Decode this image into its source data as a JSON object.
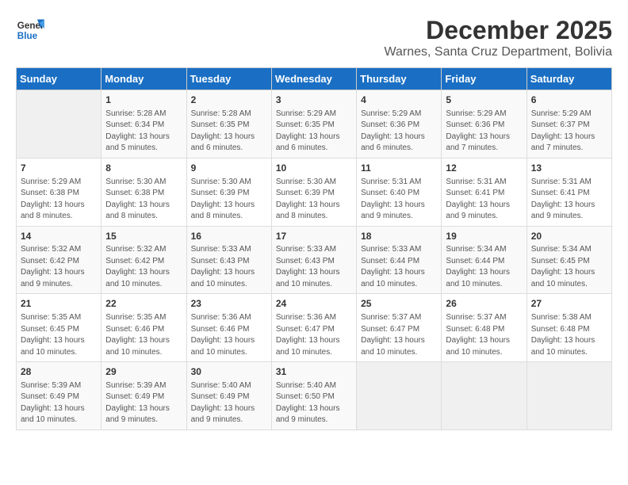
{
  "logo": {
    "line1": "General",
    "line2": "Blue"
  },
  "title": "December 2025",
  "location": "Warnes, Santa Cruz Department, Bolivia",
  "days_of_week": [
    "Sunday",
    "Monday",
    "Tuesday",
    "Wednesday",
    "Thursday",
    "Friday",
    "Saturday"
  ],
  "weeks": [
    [
      {
        "day": "",
        "info": ""
      },
      {
        "day": "1",
        "info": "Sunrise: 5:28 AM\nSunset: 6:34 PM\nDaylight: 13 hours\nand 5 minutes."
      },
      {
        "day": "2",
        "info": "Sunrise: 5:28 AM\nSunset: 6:35 PM\nDaylight: 13 hours\nand 6 minutes."
      },
      {
        "day": "3",
        "info": "Sunrise: 5:29 AM\nSunset: 6:35 PM\nDaylight: 13 hours\nand 6 minutes."
      },
      {
        "day": "4",
        "info": "Sunrise: 5:29 AM\nSunset: 6:36 PM\nDaylight: 13 hours\nand 6 minutes."
      },
      {
        "day": "5",
        "info": "Sunrise: 5:29 AM\nSunset: 6:36 PM\nDaylight: 13 hours\nand 7 minutes."
      },
      {
        "day": "6",
        "info": "Sunrise: 5:29 AM\nSunset: 6:37 PM\nDaylight: 13 hours\nand 7 minutes."
      }
    ],
    [
      {
        "day": "7",
        "info": "Sunrise: 5:29 AM\nSunset: 6:38 PM\nDaylight: 13 hours\nand 8 minutes."
      },
      {
        "day": "8",
        "info": "Sunrise: 5:30 AM\nSunset: 6:38 PM\nDaylight: 13 hours\nand 8 minutes."
      },
      {
        "day": "9",
        "info": "Sunrise: 5:30 AM\nSunset: 6:39 PM\nDaylight: 13 hours\nand 8 minutes."
      },
      {
        "day": "10",
        "info": "Sunrise: 5:30 AM\nSunset: 6:39 PM\nDaylight: 13 hours\nand 8 minutes."
      },
      {
        "day": "11",
        "info": "Sunrise: 5:31 AM\nSunset: 6:40 PM\nDaylight: 13 hours\nand 9 minutes."
      },
      {
        "day": "12",
        "info": "Sunrise: 5:31 AM\nSunset: 6:41 PM\nDaylight: 13 hours\nand 9 minutes."
      },
      {
        "day": "13",
        "info": "Sunrise: 5:31 AM\nSunset: 6:41 PM\nDaylight: 13 hours\nand 9 minutes."
      }
    ],
    [
      {
        "day": "14",
        "info": "Sunrise: 5:32 AM\nSunset: 6:42 PM\nDaylight: 13 hours\nand 9 minutes."
      },
      {
        "day": "15",
        "info": "Sunrise: 5:32 AM\nSunset: 6:42 PM\nDaylight: 13 hours\nand 10 minutes."
      },
      {
        "day": "16",
        "info": "Sunrise: 5:33 AM\nSunset: 6:43 PM\nDaylight: 13 hours\nand 10 minutes."
      },
      {
        "day": "17",
        "info": "Sunrise: 5:33 AM\nSunset: 6:43 PM\nDaylight: 13 hours\nand 10 minutes."
      },
      {
        "day": "18",
        "info": "Sunrise: 5:33 AM\nSunset: 6:44 PM\nDaylight: 13 hours\nand 10 minutes."
      },
      {
        "day": "19",
        "info": "Sunrise: 5:34 AM\nSunset: 6:44 PM\nDaylight: 13 hours\nand 10 minutes."
      },
      {
        "day": "20",
        "info": "Sunrise: 5:34 AM\nSunset: 6:45 PM\nDaylight: 13 hours\nand 10 minutes."
      }
    ],
    [
      {
        "day": "21",
        "info": "Sunrise: 5:35 AM\nSunset: 6:45 PM\nDaylight: 13 hours\nand 10 minutes."
      },
      {
        "day": "22",
        "info": "Sunrise: 5:35 AM\nSunset: 6:46 PM\nDaylight: 13 hours\nand 10 minutes."
      },
      {
        "day": "23",
        "info": "Sunrise: 5:36 AM\nSunset: 6:46 PM\nDaylight: 13 hours\nand 10 minutes."
      },
      {
        "day": "24",
        "info": "Sunrise: 5:36 AM\nSunset: 6:47 PM\nDaylight: 13 hours\nand 10 minutes."
      },
      {
        "day": "25",
        "info": "Sunrise: 5:37 AM\nSunset: 6:47 PM\nDaylight: 13 hours\nand 10 minutes."
      },
      {
        "day": "26",
        "info": "Sunrise: 5:37 AM\nSunset: 6:48 PM\nDaylight: 13 hours\nand 10 minutes."
      },
      {
        "day": "27",
        "info": "Sunrise: 5:38 AM\nSunset: 6:48 PM\nDaylight: 13 hours\nand 10 minutes."
      }
    ],
    [
      {
        "day": "28",
        "info": "Sunrise: 5:39 AM\nSunset: 6:49 PM\nDaylight: 13 hours\nand 10 minutes."
      },
      {
        "day": "29",
        "info": "Sunrise: 5:39 AM\nSunset: 6:49 PM\nDaylight: 13 hours\nand 9 minutes."
      },
      {
        "day": "30",
        "info": "Sunrise: 5:40 AM\nSunset: 6:49 PM\nDaylight: 13 hours\nand 9 minutes."
      },
      {
        "day": "31",
        "info": "Sunrise: 5:40 AM\nSunset: 6:50 PM\nDaylight: 13 hours\nand 9 minutes."
      },
      {
        "day": "",
        "info": ""
      },
      {
        "day": "",
        "info": ""
      },
      {
        "day": "",
        "info": ""
      }
    ]
  ]
}
